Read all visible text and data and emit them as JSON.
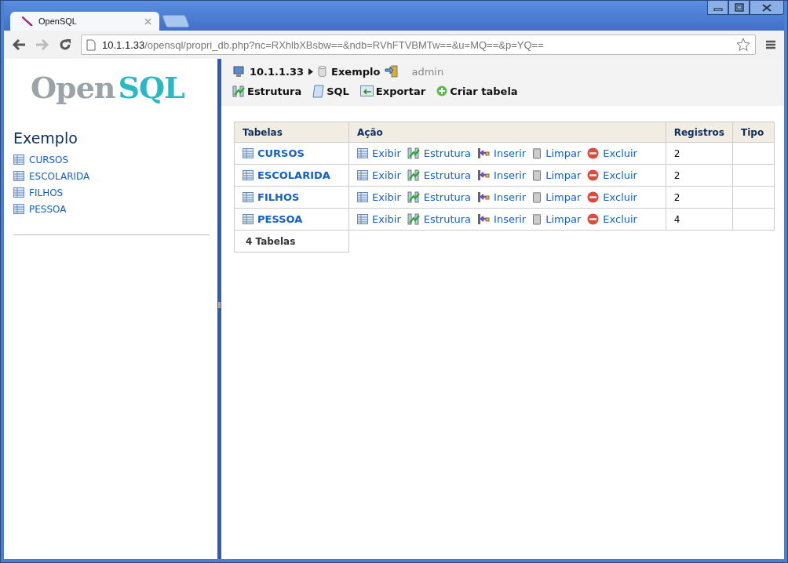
{
  "browser": {
    "tabs": [
      {
        "title": "OpenSQL",
        "selected": true
      }
    ],
    "address": {
      "host": "10.1.1.33",
      "path": "/opensql/propri_db.php?nc=RXhlbXBsbw==&ndb=RVhFTVBMTw==&u=MQ==&p=YQ=="
    }
  },
  "sidebar": {
    "logo": {
      "first": "Open",
      "second": "SQL"
    },
    "database": "Exemplo",
    "tables": [
      "CURSOS",
      "ESCOLARIDA",
      "FILHOS",
      "PESSOA"
    ]
  },
  "breadcrumb": {
    "server": "10.1.1.33",
    "database": "Exemplo",
    "user": "admin"
  },
  "toolbar": [
    {
      "label": "Estrutura",
      "kind": "structure"
    },
    {
      "label": "SQL",
      "kind": "sql"
    },
    {
      "label": "Exportar",
      "kind": "export"
    },
    {
      "label": "Criar tabela",
      "kind": "create"
    }
  ],
  "table": {
    "columns": [
      "Tabelas",
      "Ação",
      "Registros",
      "Tipo"
    ],
    "rows": [
      {
        "name": "CURSOS",
        "actions": [
          {
            "label": "Exibir",
            "kind": "browse"
          },
          {
            "label": "Estrutura",
            "kind": "structure"
          },
          {
            "label": "Inserir",
            "kind": "insert"
          },
          {
            "label": "Limpar",
            "kind": "empty"
          },
          {
            "label": "Excluir",
            "kind": "drop"
          }
        ],
        "records": "2"
      },
      {
        "name": "ESCOLARIDA",
        "actions": [
          {
            "label": "Exibir",
            "kind": "browse"
          },
          {
            "label": "Estrutura",
            "kind": "structure"
          },
          {
            "label": "Inserir",
            "kind": "insert"
          },
          {
            "label": "Limpar",
            "kind": "empty"
          },
          {
            "label": "Excluir",
            "kind": "drop"
          }
        ],
        "records": "2"
      },
      {
        "name": "FILHOS",
        "actions": [
          {
            "label": "Exibir",
            "kind": "browse"
          },
          {
            "label": "Estrutura",
            "kind": "structure"
          },
          {
            "label": "Inserir",
            "kind": "insert"
          },
          {
            "label": "Limpar",
            "kind": "empty"
          },
          {
            "label": "Excluir",
            "kind": "drop"
          }
        ],
        "records": "2"
      },
      {
        "name": "PESSOA",
        "actions": [
          {
            "label": "Exibir",
            "kind": "browse"
          },
          {
            "label": "Estrutura",
            "kind": "structure"
          },
          {
            "label": "Inserir",
            "kind": "insert"
          },
          {
            "label": "Limpar",
            "kind": "empty"
          },
          {
            "label": "Excluir",
            "kind": "drop"
          }
        ],
        "records": "4"
      }
    ],
    "footer": "4 Tabelas"
  }
}
